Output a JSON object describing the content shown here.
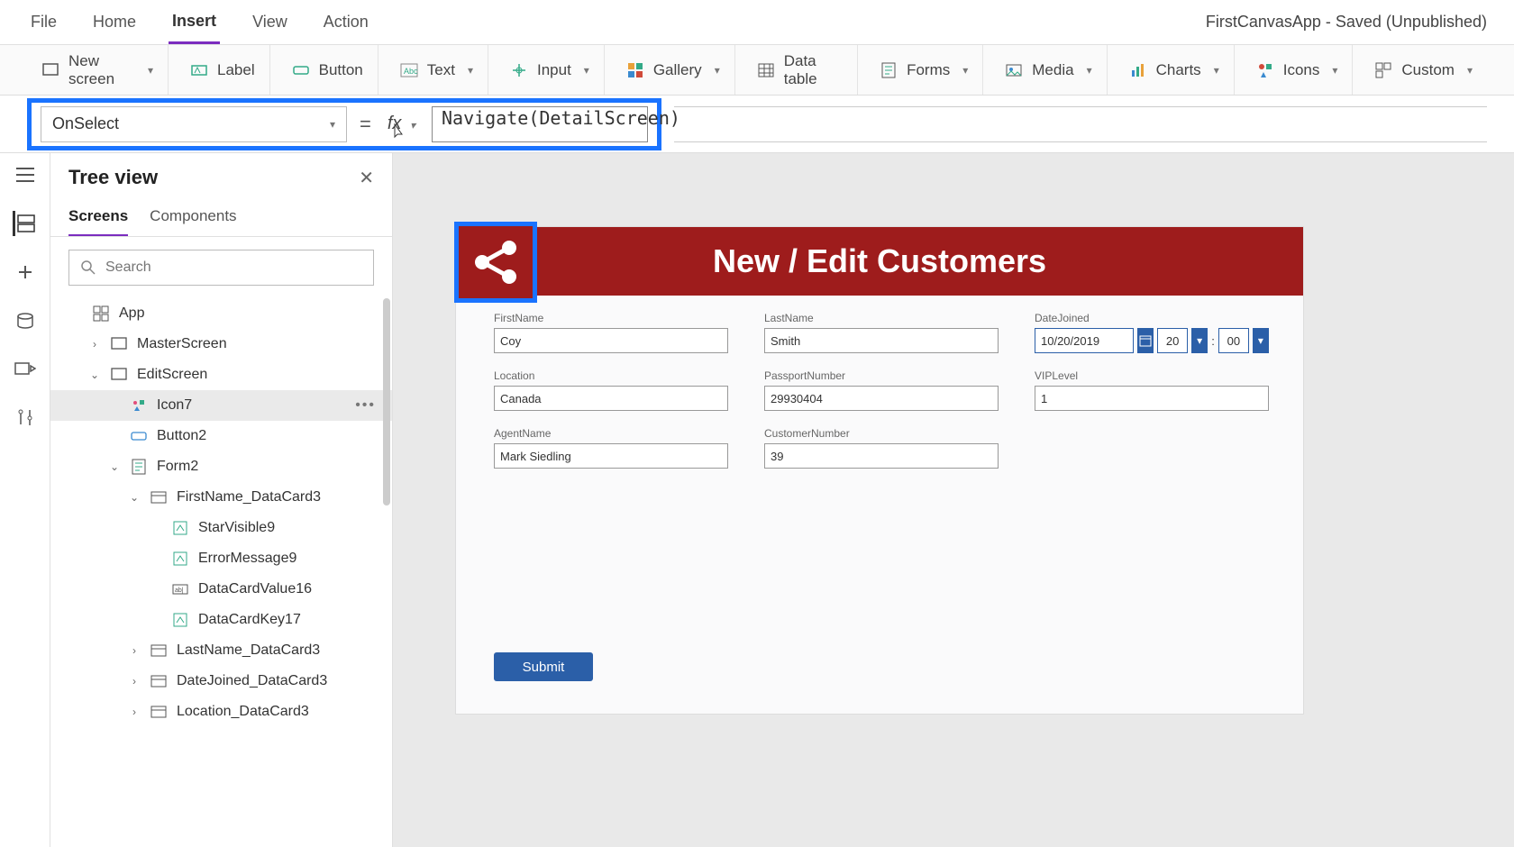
{
  "app_title": "FirstCanvasApp - Saved (Unpublished)",
  "menubar": [
    "File",
    "Home",
    "Insert",
    "View",
    "Action"
  ],
  "menubar_active": "Insert",
  "ribbon": {
    "new_screen": "New screen",
    "label": "Label",
    "button": "Button",
    "text": "Text",
    "input": "Input",
    "gallery": "Gallery",
    "data_table": "Data table",
    "forms": "Forms",
    "media": "Media",
    "charts": "Charts",
    "icons": "Icons",
    "custom": "Custom"
  },
  "formula": {
    "property": "OnSelect",
    "eq": "=",
    "fx": "fx",
    "expression": "Navigate(DetailScreen)"
  },
  "tree": {
    "title": "Tree view",
    "tabs": {
      "screens": "Screens",
      "components": "Components"
    },
    "search_placeholder": "Search",
    "items": [
      {
        "label": "App",
        "indent": 0,
        "icon": "app"
      },
      {
        "label": "MasterScreen",
        "indent": 1,
        "icon": "screen",
        "tw": "›"
      },
      {
        "label": "EditScreen",
        "indent": 1,
        "icon": "screen",
        "tw": "⌄"
      },
      {
        "label": "Icon7",
        "indent": 2,
        "icon": "icon",
        "selected": true
      },
      {
        "label": "Button2",
        "indent": 2,
        "icon": "button"
      },
      {
        "label": "Form2",
        "indent": 2,
        "icon": "form",
        "tw": "⌄"
      },
      {
        "label": "FirstName_DataCard3",
        "indent": 3,
        "icon": "card",
        "tw": "⌄"
      },
      {
        "label": "StarVisible9",
        "indent": 4,
        "icon": "ctl"
      },
      {
        "label": "ErrorMessage9",
        "indent": 4,
        "icon": "ctl"
      },
      {
        "label": "DataCardValue16",
        "indent": 4,
        "icon": "input"
      },
      {
        "label": "DataCardKey17",
        "indent": 4,
        "icon": "ctl"
      },
      {
        "label": "LastName_DataCard3",
        "indent": 3,
        "icon": "card",
        "tw": "›"
      },
      {
        "label": "DateJoined_DataCard3",
        "indent": 3,
        "icon": "card",
        "tw": "›"
      },
      {
        "label": "Location_DataCard3",
        "indent": 3,
        "icon": "card",
        "tw": "›"
      }
    ]
  },
  "canvas": {
    "header_title": "New / Edit Customers",
    "fields": {
      "firstname": {
        "label": "FirstName",
        "value": "Coy"
      },
      "lastname": {
        "label": "LastName",
        "value": "Smith"
      },
      "datejoined": {
        "label": "DateJoined",
        "value": "10/20/2019",
        "hh": "20",
        "mm": "00"
      },
      "location": {
        "label": "Location",
        "value": "Canada"
      },
      "passport": {
        "label": "PassportNumber",
        "value": "29930404"
      },
      "vip": {
        "label": "VIPLevel",
        "value": "1"
      },
      "agent": {
        "label": "AgentName",
        "value": "Mark Siedling"
      },
      "custno": {
        "label": "CustomerNumber",
        "value": "39"
      }
    },
    "submit": "Submit"
  }
}
